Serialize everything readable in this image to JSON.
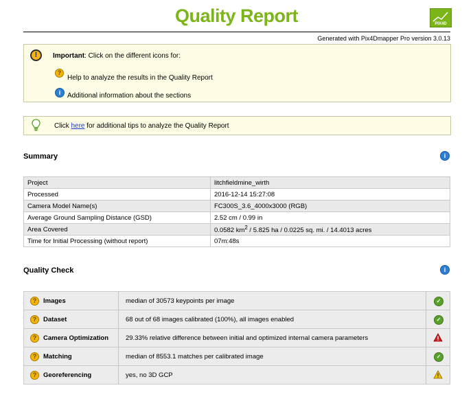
{
  "header": {
    "title": "Quality Report",
    "generated": "Generated with Pix4Dmapper Pro version 3.0.13",
    "logo_text": "PIX4D"
  },
  "notice": {
    "important_label": "Important",
    "important_text": ": Click on the different icons for:",
    "help_text": "Help to analyze the results in the Quality Report",
    "info_text": "Additional information about the sections"
  },
  "tips": {
    "prefix": "Click ",
    "link": "here",
    "suffix": " for additional tips to analyze the Quality Report"
  },
  "summary": {
    "title": "Summary",
    "rows": [
      {
        "label": "Project",
        "value": "litchfieldmine_wirth"
      },
      {
        "label": "Processed",
        "value": "2016-12-14 15:27:08"
      },
      {
        "label": "Camera Model Name(s)",
        "value": "FC300S_3.6_4000x3000 (RGB)"
      },
      {
        "label": "Average Ground Sampling Distance (GSD)",
        "value": "2.52 cm / 0.99 in"
      },
      {
        "label": "Area Covered",
        "value_a": "0.0582 km",
        "value_sup": "2",
        "value_b": " / 5.825 ha / 0.0225 sq. mi. / 14.4013 acres"
      },
      {
        "label": "Time for Initial Processing (without report)",
        "value": "07m:48s"
      }
    ]
  },
  "quality_check": {
    "title": "Quality Check",
    "rows": [
      {
        "label": "Images",
        "value": "median of 30573 keypoints per image",
        "status": "ok"
      },
      {
        "label": "Dataset",
        "value": "68 out of 68 images calibrated (100%), all images enabled",
        "status": "ok"
      },
      {
        "label": "Camera Optimization",
        "value": "29.33% relative difference between initial and optimized internal camera parameters",
        "status": "error"
      },
      {
        "label": "Matching",
        "value": "median of 8553.1 matches per calibrated image",
        "status": "ok"
      },
      {
        "label": "Georeferencing",
        "value": "yes, no 3D GCP",
        "status": "warning"
      }
    ]
  },
  "colors": {
    "title_green": "#7cb518",
    "ok_green": "#5aa02c",
    "error_red": "#d42020",
    "warning_yellow": "#f2c200",
    "info_blue": "#2d7fd6"
  }
}
